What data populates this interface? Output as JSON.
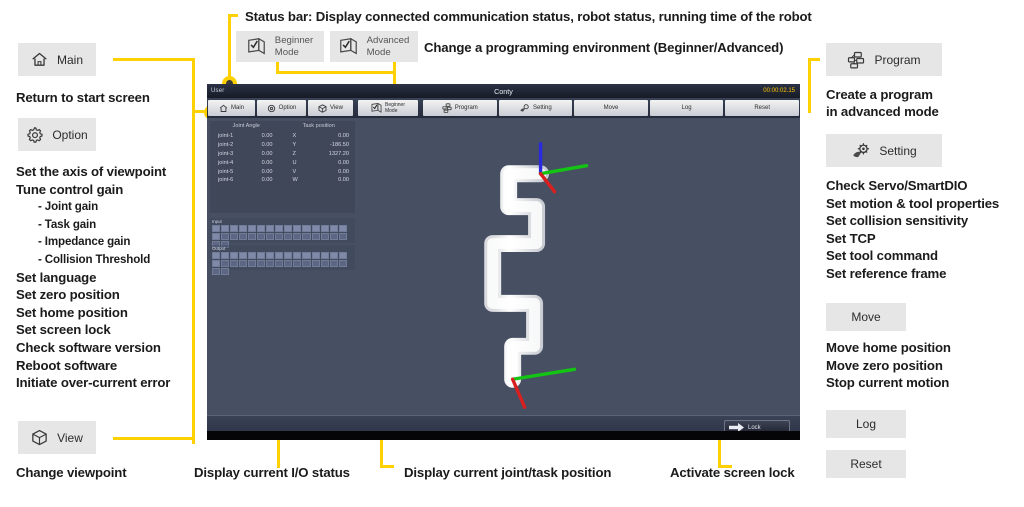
{
  "annotations": {
    "status_bar": "Status bar: Display connected communication status, robot status, running time of the robot",
    "mode_change": "Change a programming environment (Beginner/Advanced)",
    "return_start": "Return to start screen",
    "bottom_io": "Display current I/O status",
    "bottom_pos": "Display current joint/task position",
    "bottom_lock": "Activate screen lock",
    "bottom_view": "Change viewpoint",
    "program_desc_1": "Create a program",
    "program_desc_2": "in advanced mode"
  },
  "legend_left": {
    "main": {
      "label": "Main",
      "icon": "home-icon"
    },
    "option": {
      "label": "Option",
      "icon": "gear-icon"
    },
    "view": {
      "label": "View",
      "icon": "cube-icon"
    },
    "option_items": [
      "Set the axis of viewpoint",
      "Tune control gain",
      "- Joint gain",
      "- Task gain",
      "- Impedance gain",
      "- Collision Threshold",
      "Set language",
      "Set zero position",
      "Set home position",
      "Set screen lock",
      "Check software version",
      "Reboot software",
      "Initiate over-current error"
    ]
  },
  "legend_top": {
    "beginner": {
      "line1": "Beginner",
      "line2": "Mode",
      "icon": "checklist-icon"
    },
    "advanced": {
      "line1": "Advanced",
      "line2": "Mode",
      "icon": "checklist-icon"
    }
  },
  "legend_right": {
    "program": {
      "label": "Program",
      "icon": "flowchart-icon"
    },
    "setting": {
      "label": "Setting",
      "icon": "gears-icon"
    },
    "move": {
      "label": "Move"
    },
    "log": {
      "label": "Log"
    },
    "reset": {
      "label": "Reset"
    },
    "setting_items": [
      "Check Servo/SmartDIO",
      "Set motion & tool properties",
      "Set collision sensitivity",
      "Set TCP",
      "Set tool command",
      "Set reference frame"
    ],
    "move_items": [
      "Move home position",
      "Move zero position",
      "Stop current motion"
    ]
  },
  "device": {
    "statusbar": {
      "left": "User",
      "center": "Conty",
      "timer": "00:00:02.15"
    },
    "toolbar_left": [
      {
        "label": "Main",
        "icon": "home-icon"
      },
      {
        "label": "Option",
        "icon": "gear-icon"
      },
      {
        "label": "View",
        "icon": "cube-icon"
      }
    ],
    "toolbar_mode": {
      "line1": "Beginner",
      "line2": "Mode",
      "icon": "checklist-icon"
    },
    "toolbar_right": [
      {
        "label": "Program",
        "icon": "flowchart-icon"
      },
      {
        "label": "Setting",
        "icon": "gears-icon"
      },
      {
        "label": "Move",
        "icon": ""
      },
      {
        "label": "Log",
        "icon": ""
      },
      {
        "label": "Reset",
        "icon": ""
      }
    ],
    "position_panel": {
      "header_joint": "Joint Angle",
      "header_task": "Task position",
      "rows": [
        {
          "joint": "joint-1",
          "angle": "0.00",
          "axis": "X",
          "value": "0.00"
        },
        {
          "joint": "joint-2",
          "angle": "0.00",
          "axis": "Y",
          "value": "-186.50"
        },
        {
          "joint": "joint-3",
          "angle": "0.00",
          "axis": "Z",
          "value": "1327.20"
        },
        {
          "joint": "joint-4",
          "angle": "0.00",
          "axis": "U",
          "value": "0.00"
        },
        {
          "joint": "joint-5",
          "angle": "0.00",
          "axis": "V",
          "value": "0.00"
        },
        {
          "joint": "joint-6",
          "angle": "0.00",
          "axis": "W",
          "value": "0.00"
        }
      ]
    },
    "io_panel": {
      "block1_label": "Input",
      "block2_label": "Output"
    },
    "lock_button": {
      "label": "Lock",
      "icon": "arrow-right-icon"
    }
  }
}
